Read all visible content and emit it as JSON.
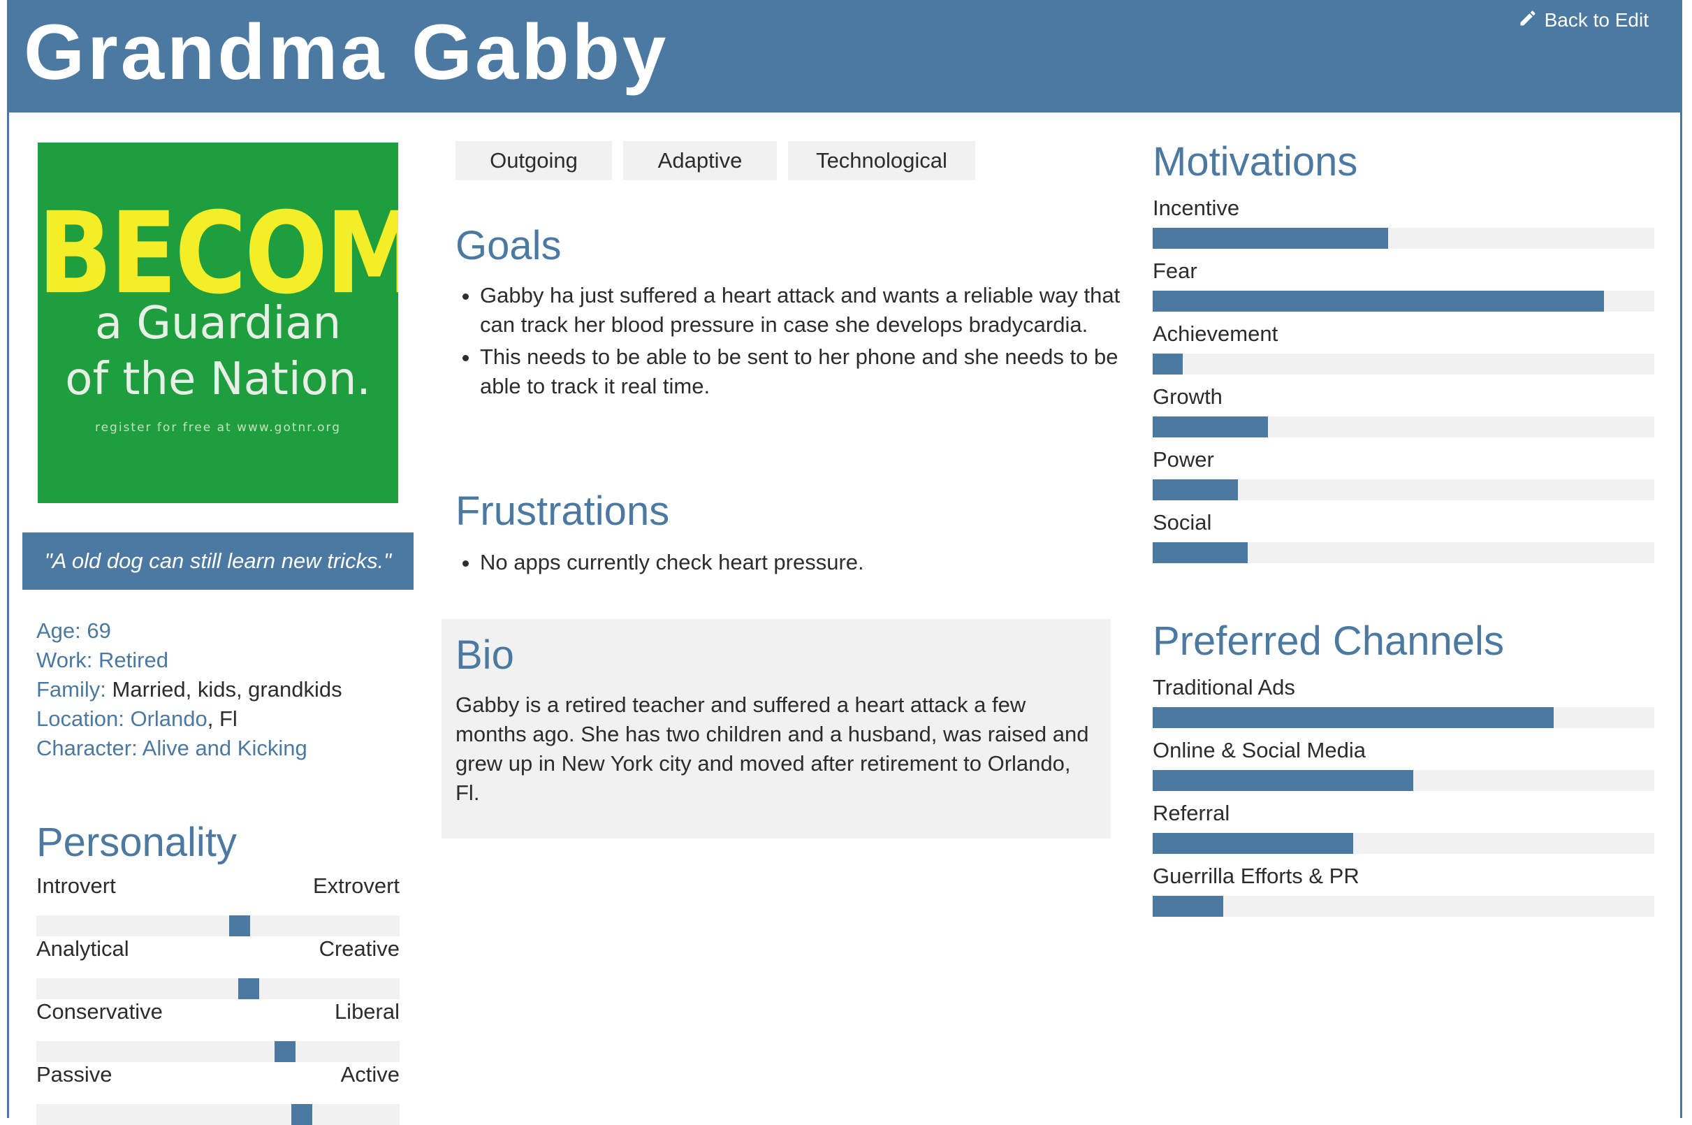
{
  "header": {
    "title": "Grandma Gabby",
    "back_label": "Back to Edit"
  },
  "photo": {
    "line1": "BECOME",
    "line2": "a Guardian",
    "line3": "of the Nation.",
    "small": "register for free at www.gotnr.org"
  },
  "quote": "\"A old dog can still learn new tricks.\"",
  "facts": {
    "age_key": "Age:",
    "age_val": "69",
    "work_key": "Work:",
    "work_val": "Retired",
    "family_key": "Family:",
    "family_val": "Married, kids, grandkids",
    "location_key": "Location:",
    "location_city": "Orlando",
    "location_state": ", Fl",
    "character_key": "Character:",
    "character_val": "Alive and Kicking"
  },
  "personality": {
    "title": "Personality",
    "traits": [
      {
        "left": "Introvert",
        "right": "Extrovert",
        "value": 0.56
      },
      {
        "left": "Analytical",
        "right": "Creative",
        "value": 0.585
      },
      {
        "left": "Conservative",
        "right": "Liberal",
        "value": 0.685
      },
      {
        "left": "Passive",
        "right": "Active",
        "value": 0.73
      }
    ]
  },
  "tags": [
    "Outgoing",
    "Adaptive",
    "Technological"
  ],
  "goals": {
    "title": "Goals",
    "items": [
      " Gabby ha just suffered a heart attack and wants a reliable way that can track her blood pressure in case she develops bradycardia.",
      "This needs to be able to be sent to her phone and she needs to be able to track it real time."
    ]
  },
  "frustrations": {
    "title": "Frustrations",
    "items": [
      "No apps currently check heart pressure."
    ]
  },
  "bio": {
    "title": "Bio",
    "text": "Gabby is a retired teacher and suffered a heart attack a few months ago. She has two children and a husband, was raised and grew up in New York city and moved after retirement  to Orlando, Fl."
  },
  "motivations": {
    "title": "Motivations",
    "items": [
      {
        "label": "Incentive",
        "value": 0.47
      },
      {
        "label": "Fear",
        "value": 0.9
      },
      {
        "label": "Achievement",
        "value": 0.06
      },
      {
        "label": "Growth",
        "value": 0.23
      },
      {
        "label": "Power",
        "value": 0.17
      },
      {
        "label": "Social",
        "value": 0.19
      }
    ]
  },
  "channels": {
    "title": "Preferred Channels",
    "items": [
      {
        "label": "Traditional Ads",
        "value": 0.8
      },
      {
        "label": "Online & Social Media",
        "value": 0.52
      },
      {
        "label": "Referral",
        "value": 0.4
      },
      {
        "label": "Guerrilla Efforts & PR",
        "value": 0.14
      }
    ]
  },
  "colors": {
    "accent": "#4b79a1",
    "track": "#f1f1f1",
    "photo_bg": "#1e9e3e",
    "photo_text": "#f4ee28"
  }
}
